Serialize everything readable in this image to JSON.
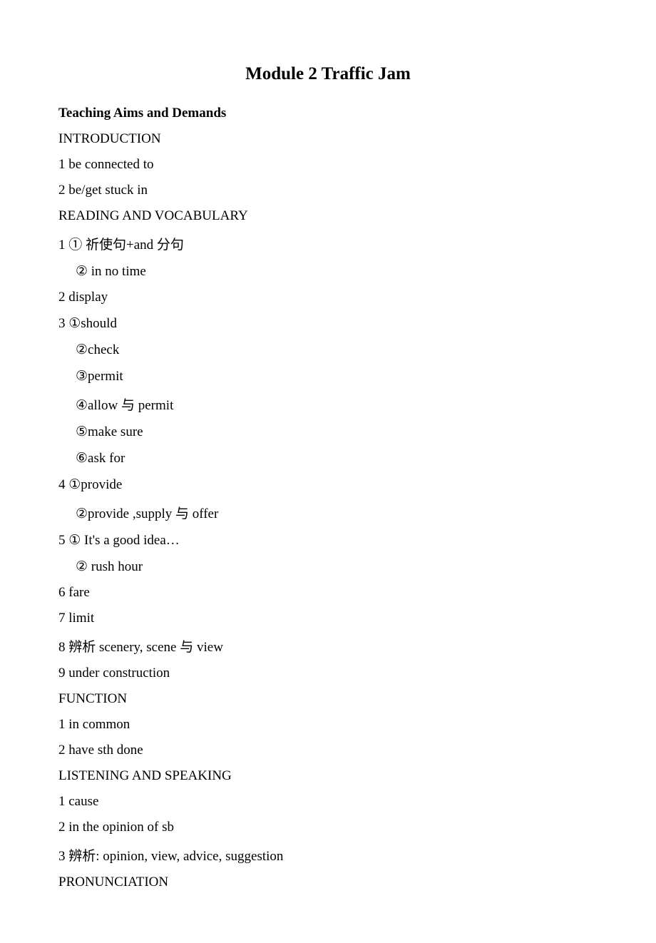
{
  "title": "Module 2 Traffic Jam",
  "heading": "Teaching Aims and Demands",
  "sections": {
    "introduction": {
      "label": "INTRODUCTION",
      "i1": "1 be connected to",
      "i2": "2 be/get stuck in"
    },
    "reading": {
      "label": "READING AND VOCABULARY",
      "r1": "1 ① 祈使句+and 分句",
      "r1b": "② in no time",
      "r2": "2 display",
      "r3": "3 ①should",
      "r3b": "②check",
      "r3c": "③permit",
      "r3d": "④allow 与 permit",
      "r3e": "⑤make sure",
      "r3f": "⑥ask for",
      "r4": "4 ①provide",
      "r4b": "②provide ,supply 与 offer",
      "r5": "5 ① It's a good idea…",
      "r5b": "② rush hour",
      "r6": "6 fare",
      "r7": "7 limit",
      "r8": "8 辨析 scenery, scene 与 view",
      "r9": "9 under construction"
    },
    "function": {
      "label": "FUNCTION",
      "f1": "1 in common",
      "f2": "2 have sth done"
    },
    "listening": {
      "label": "LISTENING AND SPEAKING",
      "l1": "1 cause",
      "l2": "2 in the opinion of sb",
      "l3": "3 辨析: opinion, view, advice, suggestion"
    },
    "pronunciation": {
      "label": "PRONUNCIATION"
    }
  }
}
